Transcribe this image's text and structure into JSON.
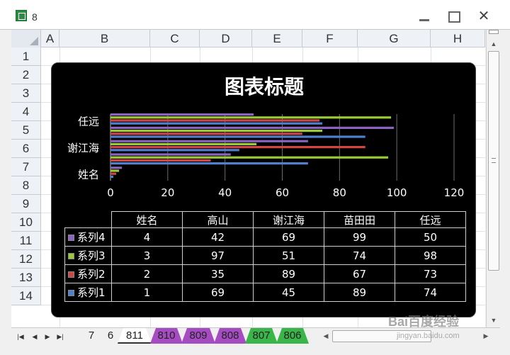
{
  "window": {
    "title": "8"
  },
  "columns": [
    "A",
    "B",
    "C",
    "D",
    "E",
    "F",
    "G",
    "H"
  ],
  "rows": [
    "1",
    "2",
    "3",
    "4",
    "5",
    "6",
    "7",
    "8",
    "9",
    "10",
    "11",
    "12",
    "13",
    "14"
  ],
  "sheet_tabs": [
    {
      "label": "7",
      "color": "#f0f0f0"
    },
    {
      "label": "6",
      "color": "#f0f0f0"
    },
    {
      "label": "811",
      "color": "#ffffff",
      "active": true
    },
    {
      "label": "810",
      "color": "#a64cc2"
    },
    {
      "label": "809",
      "color": "#a64cc2"
    },
    {
      "label": "808",
      "color": "#a64cc2"
    },
    {
      "label": "807",
      "color": "#3ab54a"
    },
    {
      "label": "806",
      "color": "#3ab54a"
    }
  ],
  "watermark": {
    "text": "Bai百度经验",
    "sub": "jingyan.baidu.com"
  },
  "chart_data": {
    "type": "bar",
    "orientation": "horizontal",
    "title": "图表标题",
    "categories": [
      "姓名",
      "高山",
      "谢江海",
      "苗田田",
      "任远"
    ],
    "y_tick_labels": [
      "任远",
      "谢江海",
      "姓名"
    ],
    "x_ticks": [
      "0",
      "20",
      "40",
      "60",
      "80",
      "100",
      "120"
    ],
    "xlim": [
      0,
      120
    ],
    "grid": true,
    "series": [
      {
        "name": "系列1",
        "values": [
          1,
          69,
          45,
          89,
          74
        ],
        "color": "#4f7fcf"
      },
      {
        "name": "系列2",
        "values": [
          2,
          35,
          89,
          67,
          73
        ],
        "color": "#d04545"
      },
      {
        "name": "系列3",
        "values": [
          3,
          97,
          51,
          74,
          98
        ],
        "color": "#9cc93a"
      },
      {
        "name": "系列4",
        "values": [
          4,
          42,
          69,
          99,
          50
        ],
        "color": "#8a64c0"
      }
    ],
    "data_table": true
  }
}
